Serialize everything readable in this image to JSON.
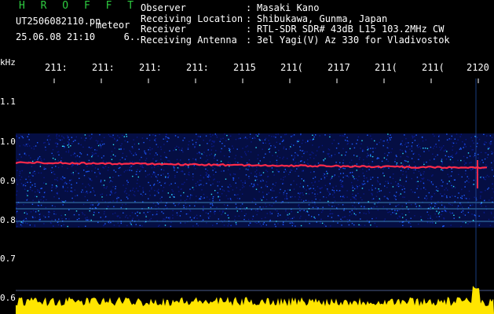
{
  "header": {
    "brand": "H R O F F T",
    "filename": "UT2506082110.pn",
    "mode": "meteor",
    "timestamp": "25.06.08 21:10",
    "timestamp_suffix": "6..",
    "info": [
      {
        "label": "Observer",
        "value": "Masaki Kano"
      },
      {
        "label": "Receiving Location",
        "value": "Shibukawa, Gunma, Japan"
      },
      {
        "label": "Receiver",
        "value": "RTL-SDR SDR# 43dB L15 103.2MHz CW"
      },
      {
        "label": "Receiving Antenna",
        "value": "3el Yagi(V) Az 330 for Vladivostok"
      }
    ]
  },
  "axes": {
    "y_unit": "kHz",
    "y_ticks": [
      "1.1",
      "1.0",
      "0.9",
      "0.8",
      "0.7",
      "0.6"
    ],
    "x_ticks": [
      "211:",
      "211:",
      "211:",
      "211:",
      "2115",
      "211(",
      "2117",
      "211(",
      "211(",
      "2120"
    ]
  },
  "colors": {
    "brand": "#2ecc40",
    "trace": "#ff2a4a",
    "noise_low": "#0a1a8a",
    "noise_mid": "#1f5cff",
    "noise_high": "#2ee6ff",
    "band_line": "#5fd0ff",
    "baseline": "#ffe500"
  }
}
